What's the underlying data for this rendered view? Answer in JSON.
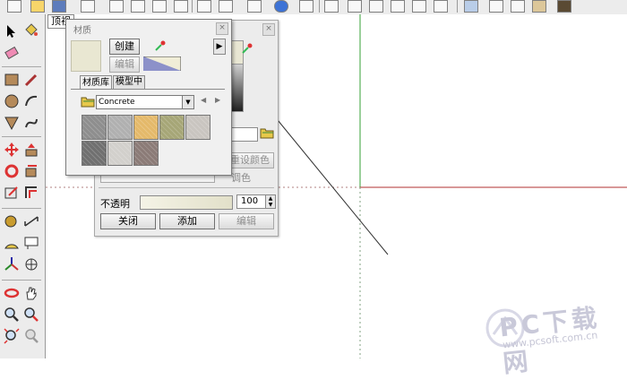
{
  "view_tab": "顶视",
  "material_window": {
    "title": "材质",
    "create_label": "创建",
    "edit_label": "编辑",
    "tabs": [
      "材质库",
      "模型中"
    ],
    "library_selected": "Concrete",
    "swatch_colors": [
      "#8e8e8e",
      "#b0b0b0",
      "#e4b96a",
      "#a6a677",
      "#c9c5c0",
      "#707070",
      "#d2d0cc",
      "#8b7b77"
    ]
  },
  "back_panel": {
    "reset_color_label": "重设颜色",
    "colorize_label": "调色",
    "opacity_label": "不透明",
    "opacity_value": "100",
    "close_label": "关闭",
    "add_label": "添加",
    "edit_label": "编辑"
  },
  "watermark": {
    "brand": "PC下载网",
    "url": "www.pcsoft.com.cn"
  },
  "colors": {
    "green_axis": "#35a035",
    "red_axis": "#b03030",
    "panel": "#ececec"
  }
}
